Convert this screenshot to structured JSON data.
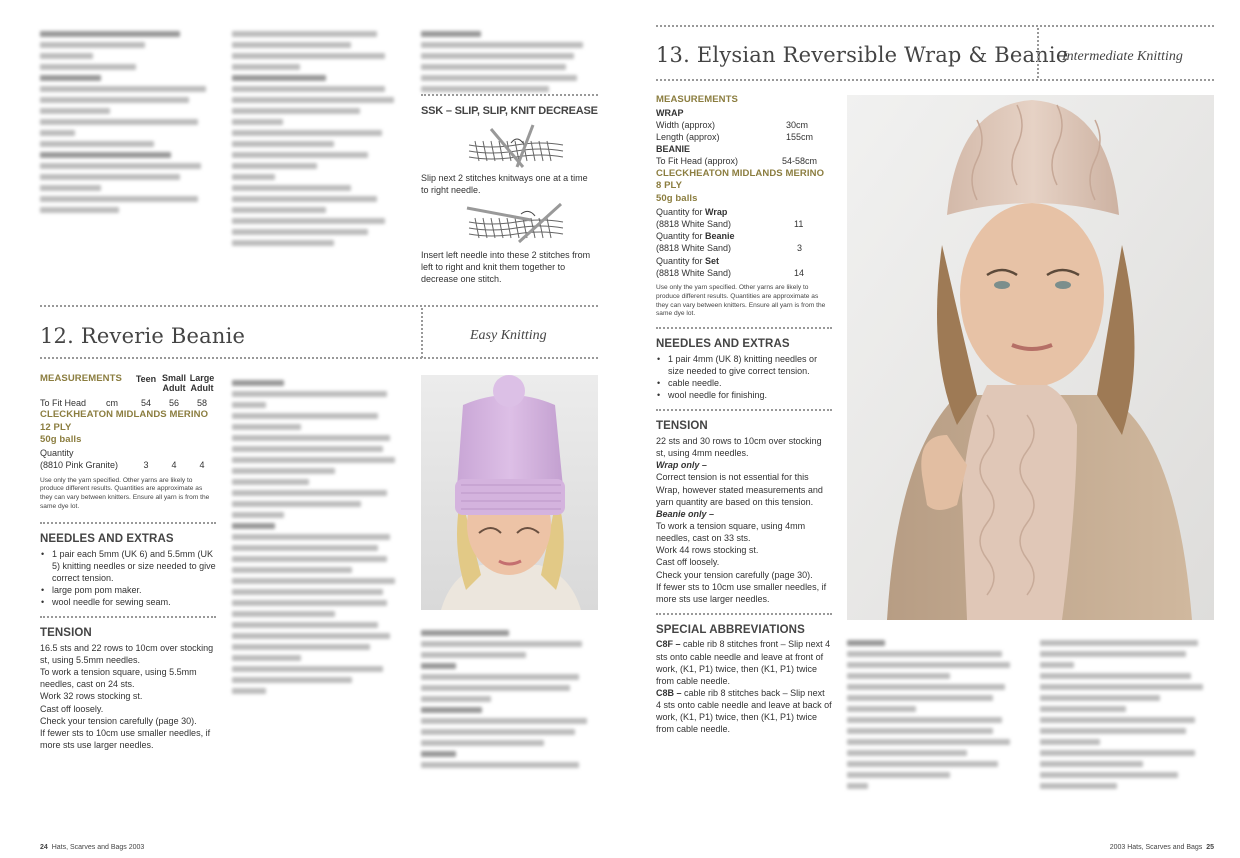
{
  "ssk": {
    "heading": "SSK – SLIP, SLIP, KNIT DECREASE",
    "step1": "Slip next 2 stitches knitways one at a time to right needle.",
    "step2": "Insert left needle into these 2 stitches from left to right and knit them together to decrease one stitch."
  },
  "beanie12": {
    "title": "12. Reverie Beanie",
    "skill": "Easy Knitting",
    "measurements_label": "MEASUREMENTS",
    "col_headers": [
      "Teen",
      "Small Adult",
      "Large Adult"
    ],
    "fit_label": "To Fit Head",
    "fit_unit": "cm",
    "fit_values": [
      "54",
      "56",
      "58"
    ],
    "yarn_name": "CLECKHEATON MIDLANDS MERINO 12 PLY",
    "yarn_unit": "50g balls",
    "quantity_label": "Quantity",
    "colour_label": "(8810 Pink Granite)",
    "quantity_values": [
      "3",
      "4",
      "4"
    ],
    "yarn_note": "Use only the yarn specified. Other yarns are likely to produce different results. Quantities are approximate as they can vary between knitters. Ensure all yarn is from the same dye lot.",
    "needles_heading": "NEEDLES AND EXTRAS",
    "needles": [
      "1 pair each 5mm (UK 6) and 5.5mm (UK 5) knitting needles or size needed to give correct tension.",
      "large pom pom maker.",
      "wool needle for sewing seam."
    ],
    "tension_heading": "TENSION",
    "tension_lines": [
      "16.5 sts and 22 rows to 10cm over stocking st, using 5.5mm needles.",
      "To work a tension square, using 5.5mm needles, cast on 24 sts.",
      "Work 32 rows stocking st.",
      "Cast off loosely.",
      "Check your tension carefully (page 30).",
      "If fewer sts to 10cm use smaller needles, if more sts use larger needles."
    ]
  },
  "wrap13": {
    "title": "13. Elysian Reversible Wrap & Beanie",
    "skill": "Intermediate Knitting",
    "measurements_label": "MEASUREMENTS",
    "wrap_label": "WRAP",
    "width_label": "Width (approx)",
    "width_value": "30cm",
    "length_label": "Length (approx)",
    "length_value": "155cm",
    "beanie_label": "BEANIE",
    "fit_label": "To Fit Head (approx)",
    "fit_value": "54-58cm",
    "yarn_name": "CLECKHEATON MIDLANDS MERINO 8 PLY",
    "yarn_unit": "50g balls",
    "qty_prefix": "Quantity for",
    "qty_wrap_word": "Wrap",
    "qty_beanie_word": "Beanie",
    "qty_set_word": "Set",
    "colour_label": "(8818 White Sand)",
    "qty_wrap_value": "11",
    "qty_beanie_value": "3",
    "qty_set_value": "14",
    "yarn_note": "Use only the yarn specified. Other yarns are likely to produce different results. Quantities are approximate as they can vary between knitters. Ensure all yarn is from the same dye lot.",
    "needles_heading": "NEEDLES AND EXTRAS",
    "needles": [
      "1 pair 4mm (UK 8) knitting needles or size needed to give correct tension.",
      "cable needle.",
      "wool needle for finishing."
    ],
    "tension_heading": "TENSION",
    "tension_intro": "22 sts and 30 rows to 10cm over stocking st, using 4mm needles.",
    "wrap_only_label": "Wrap only –",
    "wrap_only_text": "Correct tension is not essential for this Wrap, however stated measurements and yarn quantity are based on this tension.",
    "beanie_only_label": "Beanie only –",
    "beanie_only_lines": [
      "To work a tension square, using 4mm needles, cast on 33 sts.",
      "Work 44 rows stocking st.",
      "Cast off loosely.",
      "Check your tension carefully (page 30).",
      "If fewer sts to 10cm use smaller needles, if more sts use larger needles."
    ],
    "abbrev_heading": "SPECIAL ABBREVIATIONS",
    "c8f_code": "C8F –",
    "c8f_text": "cable rib 8 stitches front – Slip next 4 sts onto cable needle and leave at front of work, (K1, P1) twice, then (K1, P1) twice from cable needle.",
    "c8b_code": "C8B –",
    "c8b_text": "cable rib 8 stitches back – Slip next 4 sts onto cable needle and leave at back of work, (K1, P1) twice, then (K1, P1) twice from cable needle."
  },
  "footer": {
    "left_page": "24",
    "left_title": "Hats, Scarves and Bags 2003",
    "right_title": "2003 Hats, Scarves and Bags",
    "right_page": "25"
  }
}
